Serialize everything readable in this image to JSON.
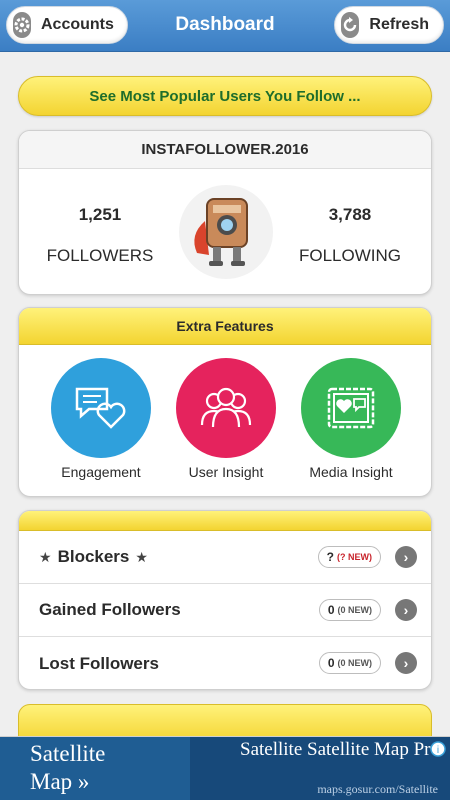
{
  "header": {
    "title": "Dashboard",
    "accounts_label": "Accounts",
    "refresh_label": "Refresh"
  },
  "banner": {
    "text": "See Most Popular Users You Follow ..."
  },
  "profile": {
    "username": "INSTAFOLLOWER.2016",
    "followers_count": "1,251",
    "followers_label": "FOLLOWERS",
    "following_count": "3,788",
    "following_label": "FOLLOWING"
  },
  "features": {
    "title": "Extra Features",
    "items": [
      {
        "label": "Engagement",
        "color": "#2fa0dc",
        "icon": "chat-heart-icon"
      },
      {
        "label": "User Insight",
        "color": "#e5235d",
        "icon": "users-icon"
      },
      {
        "label": "Media Insight",
        "color": "#37b858",
        "icon": "picture-heart-icon"
      }
    ]
  },
  "list": [
    {
      "label": "Blockers",
      "count": "?",
      "new_label": "(? NEW)",
      "starred": true
    },
    {
      "label": "Gained Followers",
      "count": "0",
      "new_label": "(0 NEW)",
      "starred": false
    },
    {
      "label": "Lost Followers",
      "count": "0",
      "new_label": "(0 NEW)",
      "starred": false
    }
  ],
  "ad": {
    "left_text_line1": "Satellite",
    "left_text_line2": "Map »",
    "title": "Satellite Satellite Map Pro",
    "url": "maps.gosur.com/Satellite"
  },
  "colors": {
    "header_blue": "#3b7ec4",
    "banner_yellow": "#f3d431",
    "banner_text": "#1e6d2b"
  }
}
